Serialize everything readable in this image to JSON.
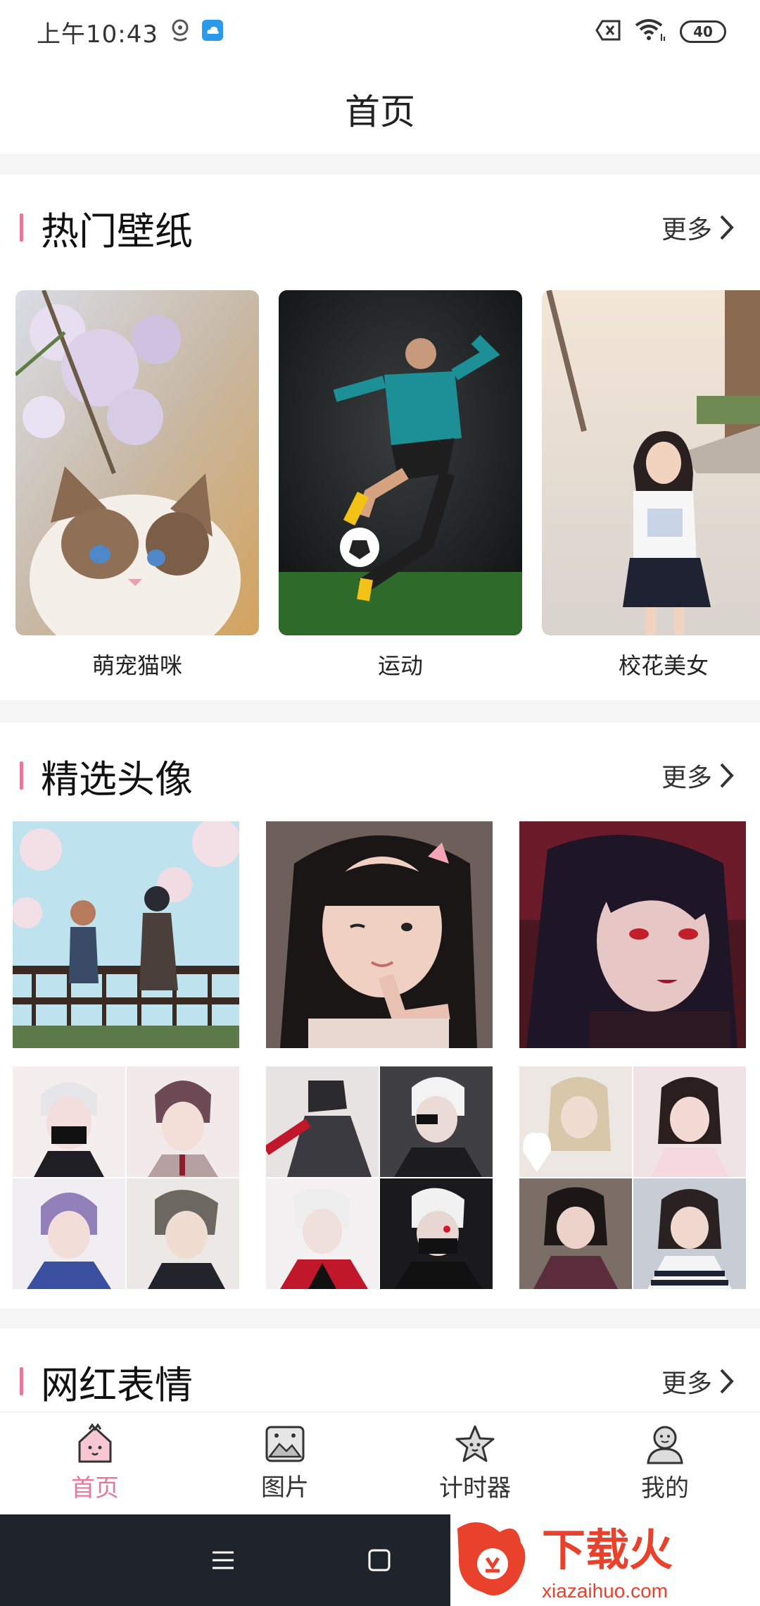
{
  "status_bar": {
    "time": "上午10:43",
    "battery": "40"
  },
  "header": {
    "title": "首页"
  },
  "sections": {
    "wallpapers": {
      "title": "热门壁纸",
      "more": "更多",
      "items": [
        {
          "label": "萌宠猫咪"
        },
        {
          "label": "运动"
        },
        {
          "label": "校花美女"
        }
      ]
    },
    "avatars": {
      "title": "精选头像",
      "more": "更多"
    },
    "stickers": {
      "title": "网红表情",
      "more": "更多"
    }
  },
  "bottom_nav": [
    {
      "label": "首页",
      "icon": "home-icon",
      "active": true
    },
    {
      "label": "图片",
      "icon": "image-icon",
      "active": false
    },
    {
      "label": "计时器",
      "icon": "star-icon",
      "active": false
    },
    {
      "label": "我的",
      "icon": "profile-icon",
      "active": false
    }
  ],
  "watermark": {
    "brand": "下载火",
    "domain": "xiazaihuo.com"
  },
  "colors": {
    "accent": "#e8789a",
    "system_nav": "#1f232b",
    "watermark_red": "#e8412c"
  }
}
